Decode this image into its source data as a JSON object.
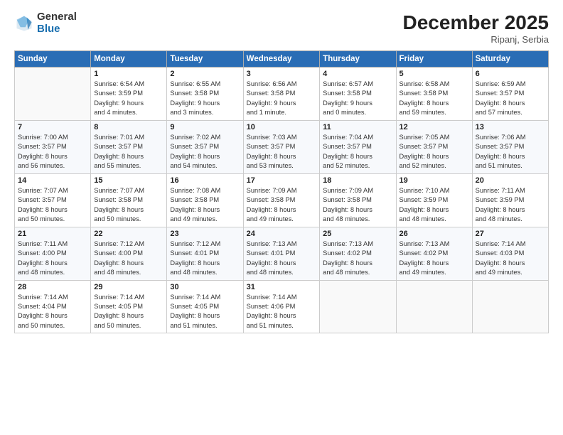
{
  "logo": {
    "general": "General",
    "blue": "Blue"
  },
  "title": "December 2025",
  "location": "Ripanj, Serbia",
  "weekdays": [
    "Sunday",
    "Monday",
    "Tuesday",
    "Wednesday",
    "Thursday",
    "Friday",
    "Saturday"
  ],
  "weeks": [
    [
      {
        "day": "",
        "details": []
      },
      {
        "day": "1",
        "details": [
          "Sunrise: 6:54 AM",
          "Sunset: 3:59 PM",
          "Daylight: 9 hours",
          "and 4 minutes."
        ]
      },
      {
        "day": "2",
        "details": [
          "Sunrise: 6:55 AM",
          "Sunset: 3:58 PM",
          "Daylight: 9 hours",
          "and 3 minutes."
        ]
      },
      {
        "day": "3",
        "details": [
          "Sunrise: 6:56 AM",
          "Sunset: 3:58 PM",
          "Daylight: 9 hours",
          "and 1 minute."
        ]
      },
      {
        "day": "4",
        "details": [
          "Sunrise: 6:57 AM",
          "Sunset: 3:58 PM",
          "Daylight: 9 hours",
          "and 0 minutes."
        ]
      },
      {
        "day": "5",
        "details": [
          "Sunrise: 6:58 AM",
          "Sunset: 3:58 PM",
          "Daylight: 8 hours",
          "and 59 minutes."
        ]
      },
      {
        "day": "6",
        "details": [
          "Sunrise: 6:59 AM",
          "Sunset: 3:57 PM",
          "Daylight: 8 hours",
          "and 57 minutes."
        ]
      }
    ],
    [
      {
        "day": "7",
        "details": [
          "Sunrise: 7:00 AM",
          "Sunset: 3:57 PM",
          "Daylight: 8 hours",
          "and 56 minutes."
        ]
      },
      {
        "day": "8",
        "details": [
          "Sunrise: 7:01 AM",
          "Sunset: 3:57 PM",
          "Daylight: 8 hours",
          "and 55 minutes."
        ]
      },
      {
        "day": "9",
        "details": [
          "Sunrise: 7:02 AM",
          "Sunset: 3:57 PM",
          "Daylight: 8 hours",
          "and 54 minutes."
        ]
      },
      {
        "day": "10",
        "details": [
          "Sunrise: 7:03 AM",
          "Sunset: 3:57 PM",
          "Daylight: 8 hours",
          "and 53 minutes."
        ]
      },
      {
        "day": "11",
        "details": [
          "Sunrise: 7:04 AM",
          "Sunset: 3:57 PM",
          "Daylight: 8 hours",
          "and 52 minutes."
        ]
      },
      {
        "day": "12",
        "details": [
          "Sunrise: 7:05 AM",
          "Sunset: 3:57 PM",
          "Daylight: 8 hours",
          "and 52 minutes."
        ]
      },
      {
        "day": "13",
        "details": [
          "Sunrise: 7:06 AM",
          "Sunset: 3:57 PM",
          "Daylight: 8 hours",
          "and 51 minutes."
        ]
      }
    ],
    [
      {
        "day": "14",
        "details": [
          "Sunrise: 7:07 AM",
          "Sunset: 3:57 PM",
          "Daylight: 8 hours",
          "and 50 minutes."
        ]
      },
      {
        "day": "15",
        "details": [
          "Sunrise: 7:07 AM",
          "Sunset: 3:58 PM",
          "Daylight: 8 hours",
          "and 50 minutes."
        ]
      },
      {
        "day": "16",
        "details": [
          "Sunrise: 7:08 AM",
          "Sunset: 3:58 PM",
          "Daylight: 8 hours",
          "and 49 minutes."
        ]
      },
      {
        "day": "17",
        "details": [
          "Sunrise: 7:09 AM",
          "Sunset: 3:58 PM",
          "Daylight: 8 hours",
          "and 49 minutes."
        ]
      },
      {
        "day": "18",
        "details": [
          "Sunrise: 7:09 AM",
          "Sunset: 3:58 PM",
          "Daylight: 8 hours",
          "and 48 minutes."
        ]
      },
      {
        "day": "19",
        "details": [
          "Sunrise: 7:10 AM",
          "Sunset: 3:59 PM",
          "Daylight: 8 hours",
          "and 48 minutes."
        ]
      },
      {
        "day": "20",
        "details": [
          "Sunrise: 7:11 AM",
          "Sunset: 3:59 PM",
          "Daylight: 8 hours",
          "and 48 minutes."
        ]
      }
    ],
    [
      {
        "day": "21",
        "details": [
          "Sunrise: 7:11 AM",
          "Sunset: 4:00 PM",
          "Daylight: 8 hours",
          "and 48 minutes."
        ]
      },
      {
        "day": "22",
        "details": [
          "Sunrise: 7:12 AM",
          "Sunset: 4:00 PM",
          "Daylight: 8 hours",
          "and 48 minutes."
        ]
      },
      {
        "day": "23",
        "details": [
          "Sunrise: 7:12 AM",
          "Sunset: 4:01 PM",
          "Daylight: 8 hours",
          "and 48 minutes."
        ]
      },
      {
        "day": "24",
        "details": [
          "Sunrise: 7:13 AM",
          "Sunset: 4:01 PM",
          "Daylight: 8 hours",
          "and 48 minutes."
        ]
      },
      {
        "day": "25",
        "details": [
          "Sunrise: 7:13 AM",
          "Sunset: 4:02 PM",
          "Daylight: 8 hours",
          "and 48 minutes."
        ]
      },
      {
        "day": "26",
        "details": [
          "Sunrise: 7:13 AM",
          "Sunset: 4:02 PM",
          "Daylight: 8 hours",
          "and 49 minutes."
        ]
      },
      {
        "day": "27",
        "details": [
          "Sunrise: 7:14 AM",
          "Sunset: 4:03 PM",
          "Daylight: 8 hours",
          "and 49 minutes."
        ]
      }
    ],
    [
      {
        "day": "28",
        "details": [
          "Sunrise: 7:14 AM",
          "Sunset: 4:04 PM",
          "Daylight: 8 hours",
          "and 50 minutes."
        ]
      },
      {
        "day": "29",
        "details": [
          "Sunrise: 7:14 AM",
          "Sunset: 4:05 PM",
          "Daylight: 8 hours",
          "and 50 minutes."
        ]
      },
      {
        "day": "30",
        "details": [
          "Sunrise: 7:14 AM",
          "Sunset: 4:05 PM",
          "Daylight: 8 hours",
          "and 51 minutes."
        ]
      },
      {
        "day": "31",
        "details": [
          "Sunrise: 7:14 AM",
          "Sunset: 4:06 PM",
          "Daylight: 8 hours",
          "and 51 minutes."
        ]
      },
      {
        "day": "",
        "details": []
      },
      {
        "day": "",
        "details": []
      },
      {
        "day": "",
        "details": []
      }
    ]
  ]
}
